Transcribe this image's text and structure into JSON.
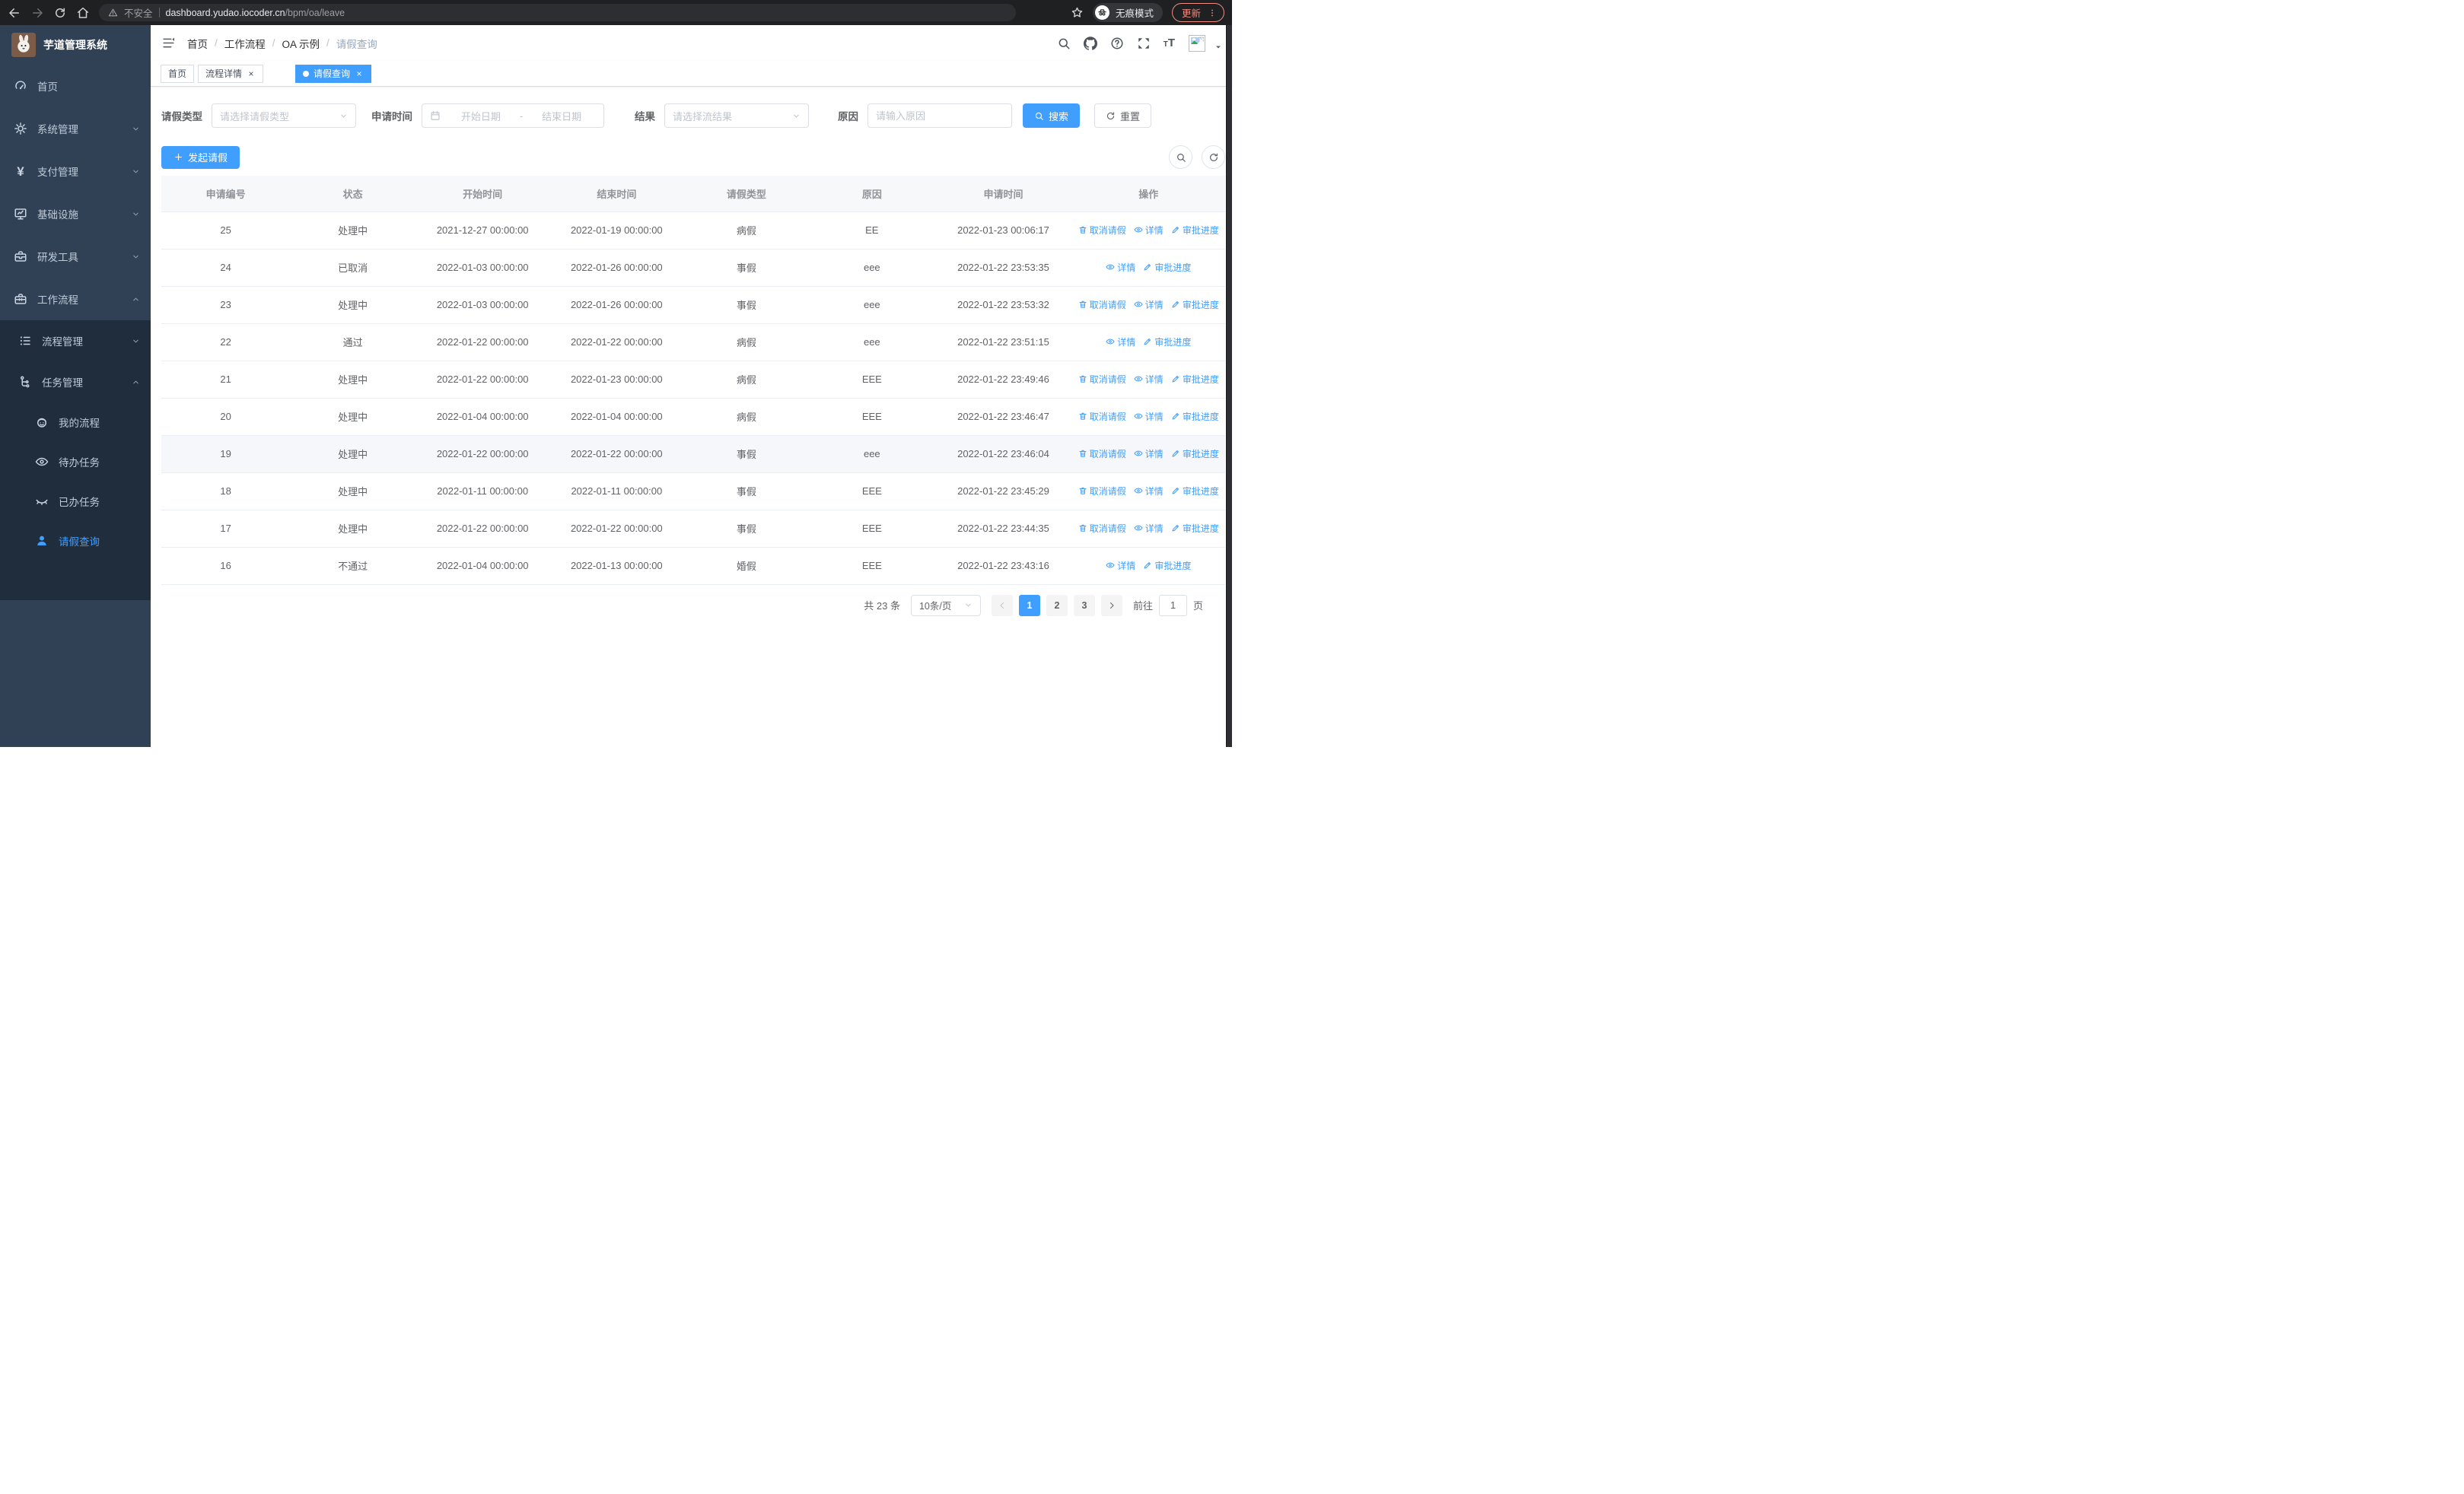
{
  "browser": {
    "security_label": "不安全",
    "url_host": "dashboard.yudao.iocoder.cn",
    "url_path": "/bpm/oa/leave",
    "incognito_label": "无痕模式",
    "update_label": "更新"
  },
  "sidebar": {
    "app_title": "芋道管理系统",
    "menu_top": [
      {
        "key": "home",
        "label": "首页",
        "icon": "dashboard",
        "level": 1
      },
      {
        "key": "system",
        "label": "系统管理",
        "icon": "gear",
        "level": 1,
        "chevron": "down"
      },
      {
        "key": "payment",
        "label": "支付管理",
        "icon": "yen",
        "level": 1,
        "chevron": "down"
      },
      {
        "key": "infra",
        "label": "基础设施",
        "icon": "monitor",
        "level": 1,
        "chevron": "down"
      },
      {
        "key": "devtools",
        "label": "研发工具",
        "icon": "toolbox",
        "level": 1,
        "chevron": "down"
      },
      {
        "key": "workflow",
        "label": "工作流程",
        "icon": "briefcase",
        "level": 1,
        "chevron": "up"
      }
    ],
    "submenu": [
      {
        "key": "process-mgmt",
        "label": "流程管理",
        "icon": "list",
        "level": 2,
        "chevron": "down"
      },
      {
        "key": "task-mgmt",
        "label": "任务管理",
        "icon": "tree",
        "level": 2,
        "chevron": "up"
      },
      {
        "key": "my-process",
        "label": "我的流程",
        "icon": "robot",
        "level": 3
      },
      {
        "key": "todo-tasks",
        "label": "待办任务",
        "icon": "eye",
        "level": 3
      },
      {
        "key": "done-tasks",
        "label": "已办任务",
        "icon": "eye-closed",
        "level": 3
      },
      {
        "key": "leave-query",
        "label": "请假查询",
        "icon": "user",
        "level": 3,
        "active": true
      }
    ]
  },
  "header": {
    "breadcrumb": [
      "首页",
      "工作流程",
      "OA 示例",
      "请假查询"
    ]
  },
  "tabs": [
    {
      "label": "首页",
      "active": false,
      "closable": false
    },
    {
      "label": "流程详情",
      "active": false,
      "closable": true
    },
    {
      "label": "请假查询",
      "active": true,
      "closable": true
    }
  ],
  "filters": {
    "leave_type_label": "请假类型",
    "leave_type_placeholder": "请选择请假类型",
    "apply_time_label": "申请时间",
    "date_start_placeholder": "开始日期",
    "date_separator": "-",
    "date_end_placeholder": "结束日期",
    "result_label": "结果",
    "result_placeholder": "请选择流结果",
    "reason_label": "原因",
    "reason_placeholder": "请输入原因",
    "search_label": "搜索",
    "reset_label": "重置"
  },
  "toolbar": {
    "create_label": "发起请假"
  },
  "table": {
    "columns": [
      "申请编号",
      "状态",
      "开始时间",
      "结束时间",
      "请假类型",
      "原因",
      "申请时间",
      "操作"
    ],
    "action_labels": {
      "cancel": "取消请假",
      "detail": "详情",
      "progress": "审批进度"
    },
    "rows": [
      {
        "id": "25",
        "status": "处理中",
        "start": "2021-12-27 00:00:00",
        "end": "2022-01-19 00:00:00",
        "type": "病假",
        "reason": "EE",
        "applied": "2022-01-23 00:06:17",
        "actions": [
          "cancel",
          "detail",
          "progress"
        ]
      },
      {
        "id": "24",
        "status": "已取消",
        "start": "2022-01-03 00:00:00",
        "end": "2022-01-26 00:00:00",
        "type": "事假",
        "reason": "eee",
        "applied": "2022-01-22 23:53:35",
        "actions": [
          "detail",
          "progress"
        ]
      },
      {
        "id": "23",
        "status": "处理中",
        "start": "2022-01-03 00:00:00",
        "end": "2022-01-26 00:00:00",
        "type": "事假",
        "reason": "eee",
        "applied": "2022-01-22 23:53:32",
        "actions": [
          "cancel",
          "detail",
          "progress"
        ]
      },
      {
        "id": "22",
        "status": "通过",
        "start": "2022-01-22 00:00:00",
        "end": "2022-01-22 00:00:00",
        "type": "病假",
        "reason": "eee",
        "applied": "2022-01-22 23:51:15",
        "actions": [
          "detail",
          "progress"
        ]
      },
      {
        "id": "21",
        "status": "处理中",
        "start": "2022-01-22 00:00:00",
        "end": "2022-01-23 00:00:00",
        "type": "病假",
        "reason": "EEE",
        "applied": "2022-01-22 23:49:46",
        "actions": [
          "cancel",
          "detail",
          "progress"
        ]
      },
      {
        "id": "20",
        "status": "处理中",
        "start": "2022-01-04 00:00:00",
        "end": "2022-01-04 00:00:00",
        "type": "病假",
        "reason": "EEE",
        "applied": "2022-01-22 23:46:47",
        "actions": [
          "cancel",
          "detail",
          "progress"
        ]
      },
      {
        "id": "19",
        "status": "处理中",
        "start": "2022-01-22 00:00:00",
        "end": "2022-01-22 00:00:00",
        "type": "事假",
        "reason": "eee",
        "applied": "2022-01-22 23:46:04",
        "actions": [
          "cancel",
          "detail",
          "progress"
        ],
        "hover": true
      },
      {
        "id": "18",
        "status": "处理中",
        "start": "2022-01-11 00:00:00",
        "end": "2022-01-11 00:00:00",
        "type": "事假",
        "reason": "EEE",
        "applied": "2022-01-22 23:45:29",
        "actions": [
          "cancel",
          "detail",
          "progress"
        ]
      },
      {
        "id": "17",
        "status": "处理中",
        "start": "2022-01-22 00:00:00",
        "end": "2022-01-22 00:00:00",
        "type": "事假",
        "reason": "EEE",
        "applied": "2022-01-22 23:44:35",
        "actions": [
          "cancel",
          "detail",
          "progress"
        ]
      },
      {
        "id": "16",
        "status": "不通过",
        "start": "2022-01-04 00:00:00",
        "end": "2022-01-13 00:00:00",
        "type": "婚假",
        "reason": "EEE",
        "applied": "2022-01-22 23:43:16",
        "actions": [
          "detail",
          "progress"
        ]
      }
    ]
  },
  "pagination": {
    "total_label": "共 23 条",
    "page_size": "10条/页",
    "pages": [
      "1",
      "2",
      "3"
    ],
    "active_page": "1",
    "goto_label": "前往",
    "goto_value": "1",
    "page_unit": "页"
  },
  "colors": {
    "primary": "#409eff",
    "sidebar": "#304156",
    "submenu": "#1f2d3d"
  }
}
